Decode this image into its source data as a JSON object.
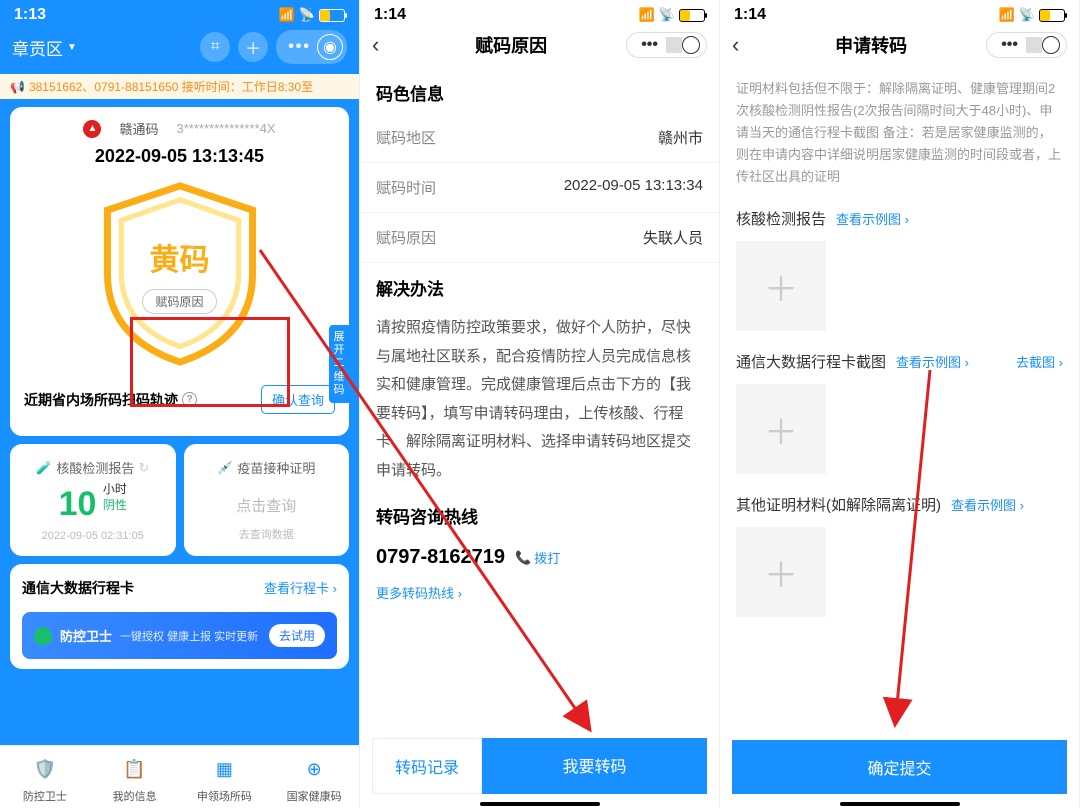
{
  "screen1": {
    "status_time": "1:13",
    "location": "章贡区",
    "ticker": "38151662、0791-88151650 接听时间：工作日8:30至",
    "code_name": "赣通码",
    "id_mask": "3***************4X",
    "timestamp": "2022-09-05 13:13:45",
    "code_status": "黄码",
    "reason_btn": "赋码原因",
    "expand_label": "展开二维码",
    "trace_title": "近期省内场所码扫码轨迹",
    "confirm_btn": "确认查询",
    "nucleic": {
      "title": "核酸检测报告",
      "value": "10",
      "unit": "小时",
      "result": "阴性",
      "time": "2022-09-05 02:31:05"
    },
    "vaccine": {
      "title": "疫苗接种证明",
      "click": "点击查询",
      "sub": "去查询数据"
    },
    "travel_title": "通信大数据行程卡",
    "travel_link": "查看行程卡",
    "banner_title": "防控卫士",
    "banner_sub": "一键授权 健康上报 实时更新",
    "banner_btn": "去试用",
    "tabs": [
      "防控卫士",
      "我的信息",
      "申领场所码",
      "国家健康码"
    ]
  },
  "screen2": {
    "status_time": "1:14",
    "nav_title": "赋码原因",
    "section1": "码色信息",
    "region_k": "赋码地区",
    "region_v": "赣州市",
    "time_k": "赋码时间",
    "time_v": "2022-09-05 13:13:34",
    "reason_k": "赋码原因",
    "reason_v": "失联人员",
    "section2": "解决办法",
    "solution_text": "请按照疫情防控政策要求，做好个人防护，尽快与属地社区联系，配合疫情防控人员完成信息核实和健康管理。完成健康管理后点击下方的【我要转码】，填写申请转码理由，上传核酸、行程卡、解除隔离证明材料、选择申请转码地区提交申请转码。",
    "section3": "转码咨询热线",
    "hotline": "0797-8162719",
    "dial": "拨打",
    "more_hotline": "更多转码热线",
    "btn_sec": "转码记录",
    "btn_pri": "我要转码"
  },
  "screen3": {
    "status_time": "1:14",
    "nav_title": "申请转码",
    "desc": "证明材料包括但不限于：解除隔离证明、健康管理期间2次核酸检测阴性报告(2次报告间隔时间大于48小时)、申请当天的通信行程卡截图 备注：若是居家健康监测的，则在申请内容中详细说明居家健康监测的时间段或者，上传社区出具的证明",
    "up1_label": "核酸检测报告",
    "example": "查看示例图",
    "up2_label": "通信大数据行程卡截图",
    "cut_link": "去截图",
    "up3_label": "其他证明材料(如解除隔离证明)",
    "submit": "确定提交"
  }
}
